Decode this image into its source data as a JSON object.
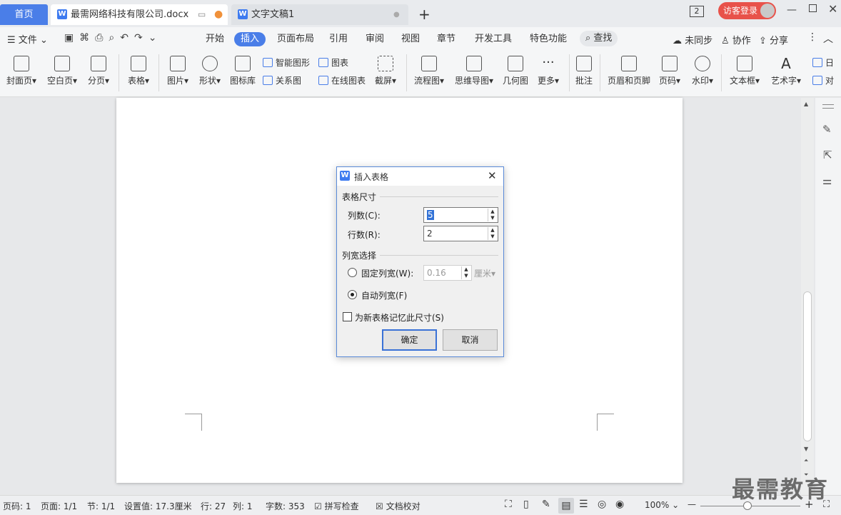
{
  "tabs": {
    "home": "首页",
    "doc1": "最需网络科技有限公司.docx",
    "doc2": "文字文稿1",
    "new_tab": "+",
    "badge": "2",
    "login": "访客登录"
  },
  "menu": {
    "file": "文件",
    "tabs": [
      "开始",
      "插入",
      "页面布局",
      "引用",
      "审阅",
      "视图",
      "章节",
      "开发工具",
      "特色功能"
    ],
    "active_tab": "插入",
    "search": "查找",
    "sync": "未同步",
    "collab": "协作",
    "share": "分享"
  },
  "ribbon": {
    "cover": "封面页",
    "blank": "空白页",
    "pagebreak": "分页",
    "table": "表格",
    "picture": "图片",
    "shape": "形状",
    "iconlib": "图标库",
    "smartart": "智能图形",
    "chart": "图表",
    "relation": "关系图",
    "onlinechart": "在线图表",
    "screenshot": "截屏",
    "flowchart": "流程图",
    "mindmap": "思维导图",
    "geometry": "几何图",
    "more": "更多",
    "comment": "批注",
    "headerfooter": "页眉和页脚",
    "pagenum": "页码",
    "watermark": "水印",
    "textbox": "文本框",
    "wordart": "艺术字",
    "date": "日",
    "object": "对"
  },
  "dialog": {
    "title": "插入表格",
    "size_group": "表格尺寸",
    "cols_label": "列数(C):",
    "cols_value": "5",
    "rows_label": "行数(R):",
    "rows_value": "2",
    "width_group": "列宽选择",
    "fixed_label": "固定列宽(W):",
    "fixed_value": "0.16",
    "fixed_unit": "厘米",
    "auto_label": "自动列宽(F)",
    "remember_label": "为新表格记忆此尺寸(S)",
    "ok": "确定",
    "cancel": "取消"
  },
  "status": {
    "page": "页码: 1",
    "pages": "页面: 1/1",
    "section": "节: 1/1",
    "setting": "设置值: 17.3厘米",
    "line": "行: 27",
    "col": "列: 1",
    "words": "字数: 353",
    "spell": "拼写检查",
    "proof": "文档校对",
    "zoom": "100%"
  },
  "watermark_text": "最需教育"
}
